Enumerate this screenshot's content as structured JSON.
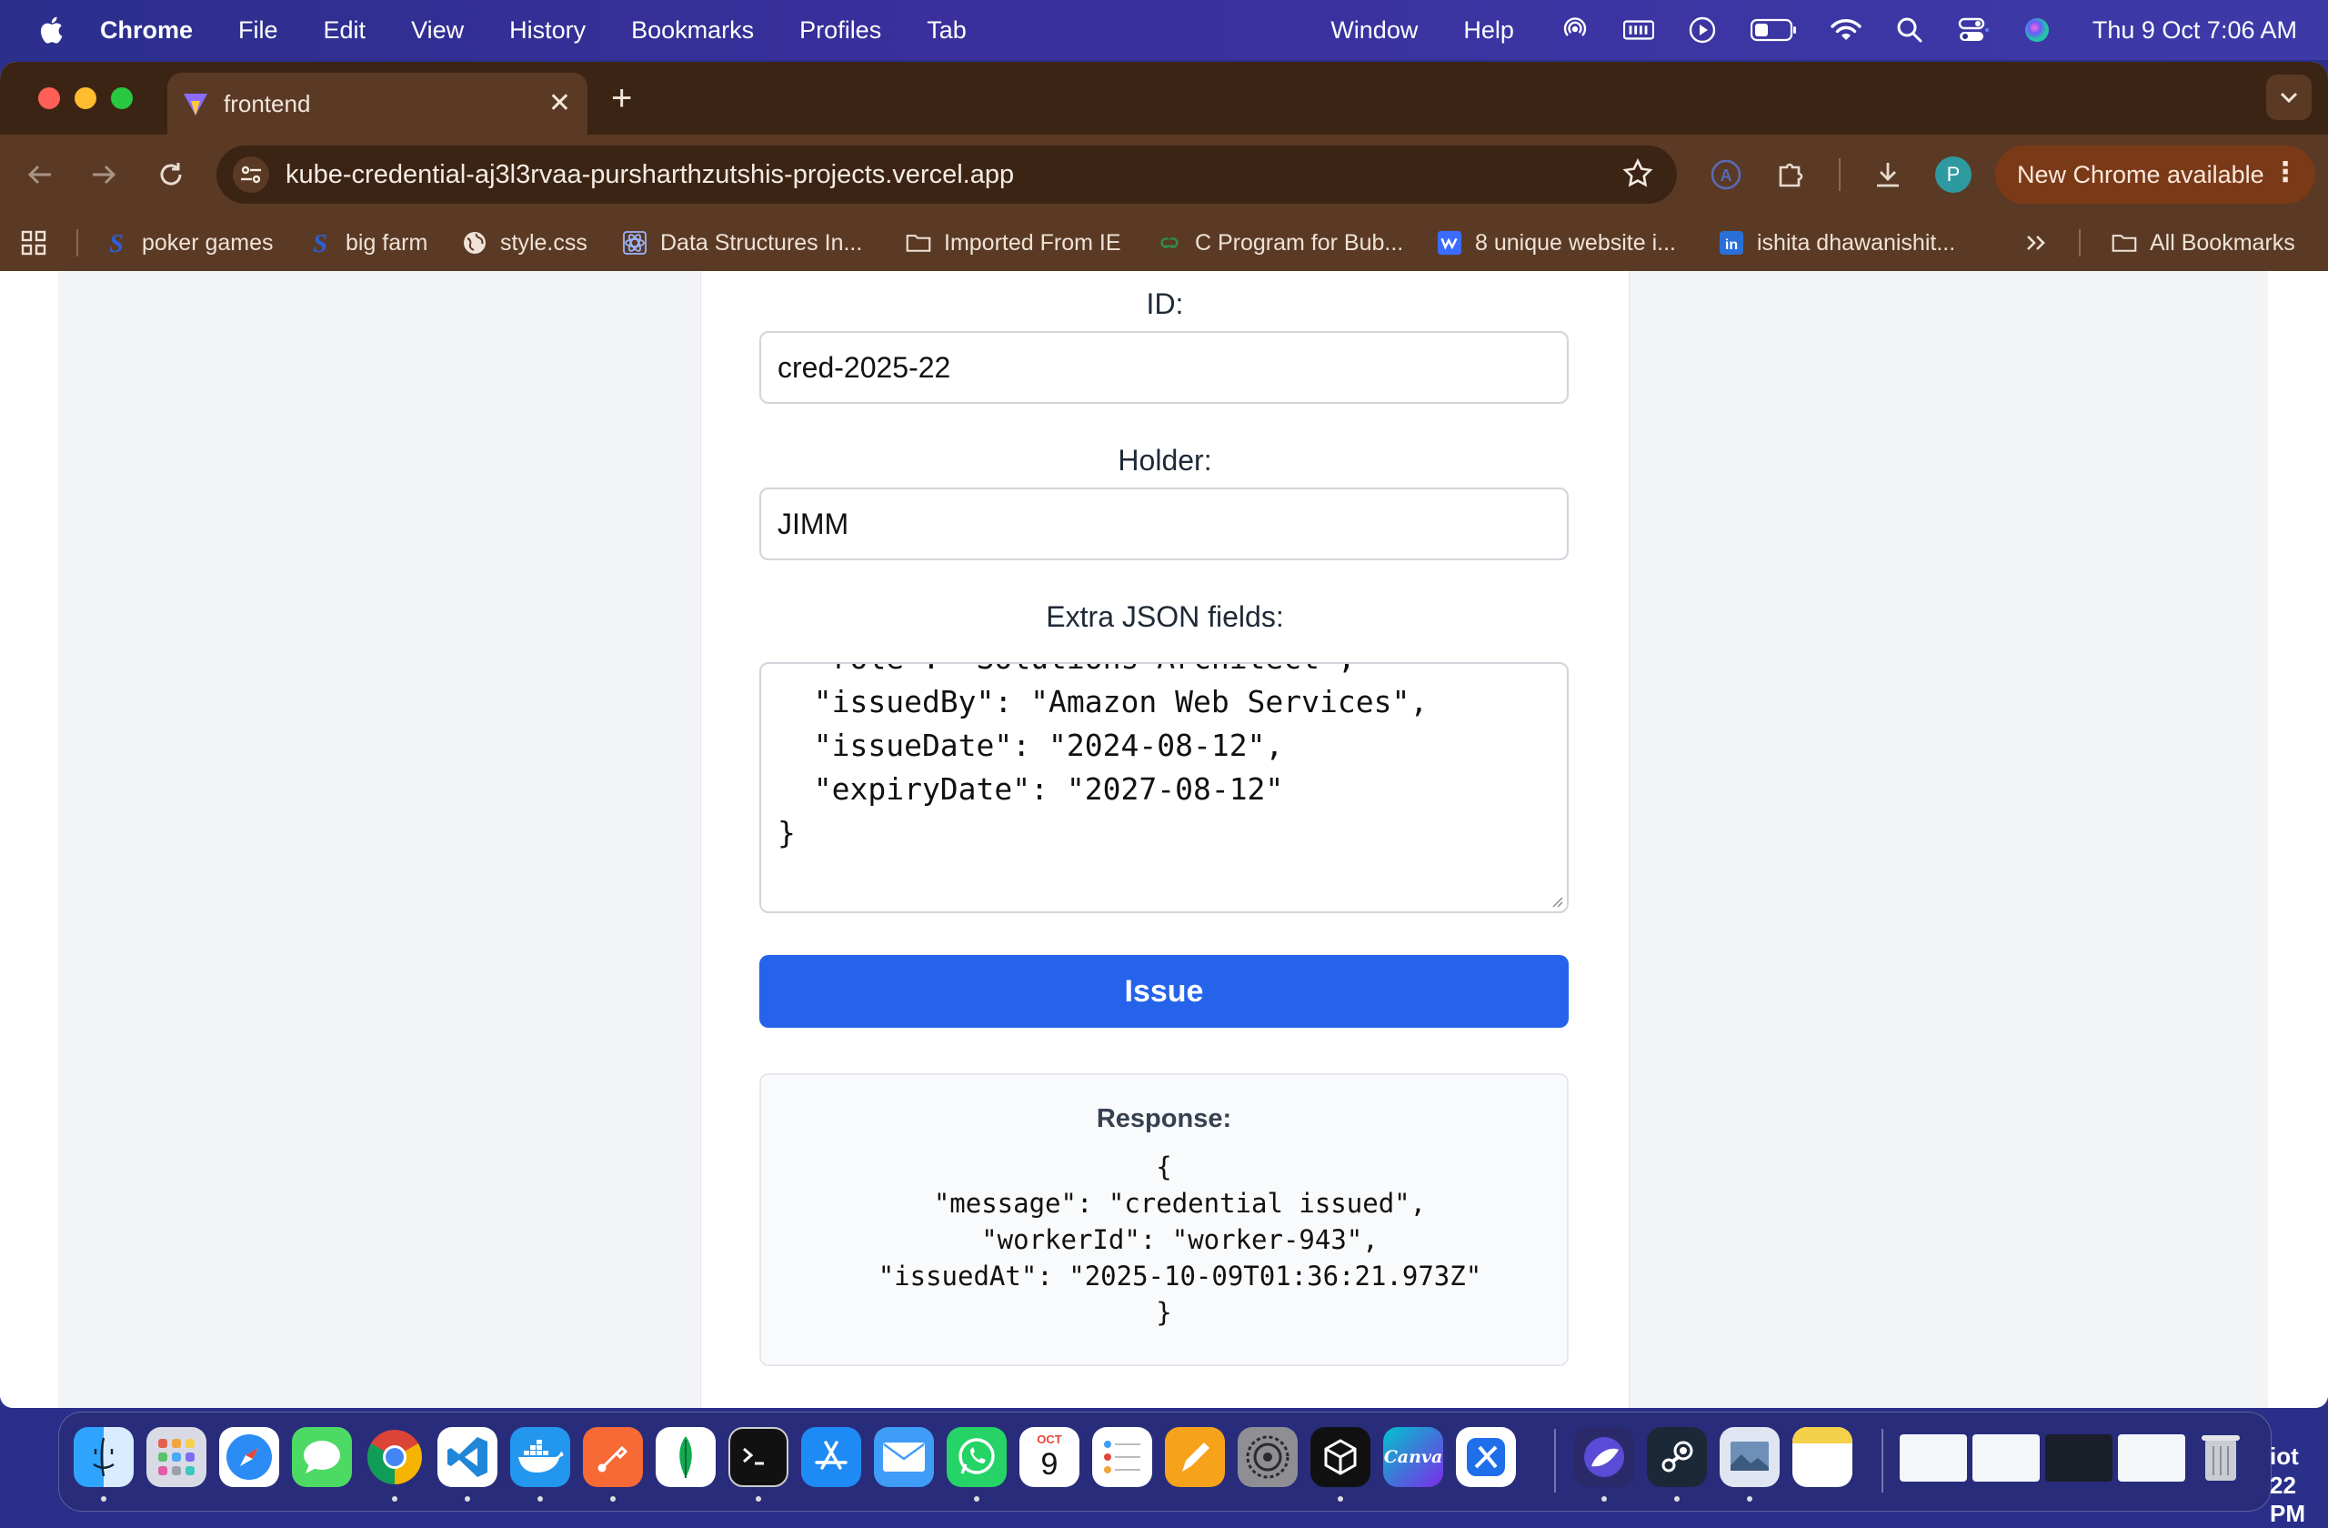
{
  "menubar": {
    "app": "Chrome",
    "items": [
      "File",
      "Edit",
      "View",
      "History",
      "Bookmarks",
      "Profiles",
      "Tab"
    ],
    "right_items": [
      "Window",
      "Help"
    ],
    "clock": "Thu 9 Oct  7:06 AM"
  },
  "tab": {
    "title": "frontend",
    "close": "✕",
    "new": "+"
  },
  "address": {
    "url": "kube-credential-aj3l3rvaa-pursharthzutshis-projects.vercel.app"
  },
  "profile": {
    "initial": "P"
  },
  "update": {
    "label": "New Chrome available"
  },
  "bookmarks": [
    {
      "label": "poker games"
    },
    {
      "label": "big farm"
    },
    {
      "label": "style.css"
    },
    {
      "label": "Data Structures In..."
    },
    {
      "label": "Imported From IE"
    },
    {
      "label": "C Program for Bub..."
    },
    {
      "label": "8 unique website i..."
    },
    {
      "label": "ishita dhawanishit..."
    },
    {
      "label": "All Bookmarks"
    }
  ],
  "form": {
    "id_label": "ID:",
    "id_value": "cred-2025-22",
    "holder_label": "Holder:",
    "holder_value": "JIMM",
    "extra_label": "Extra JSON fields:",
    "extra_value": "  \"role\": \"Solutions Architect\",\n  \"issuedBy\": \"Amazon Web Services\",\n  \"issueDate\": \"2024-08-12\",\n  \"expiryDate\": \"2027-08-12\"\n}",
    "issue_label": "Issue"
  },
  "response": {
    "title": "Response:",
    "body": "{\n  \"message\": \"credential issued\",\n  \"workerId\": \"worker-943\",\n  \"issuedAt\": \"2025-10-09T01:36:21.973Z\"\n}"
  },
  "dock": {
    "calendar_month": "OCT",
    "calendar_day": "9",
    "canva": "Canva",
    "edge_top": "iot",
    "edge_bottom": "22 PM"
  },
  "colors": {
    "primary_button": "#2563eb",
    "tab_strip": "#3c2414",
    "toolbar": "#5a3a24",
    "menubar": "#2b2f8c"
  }
}
